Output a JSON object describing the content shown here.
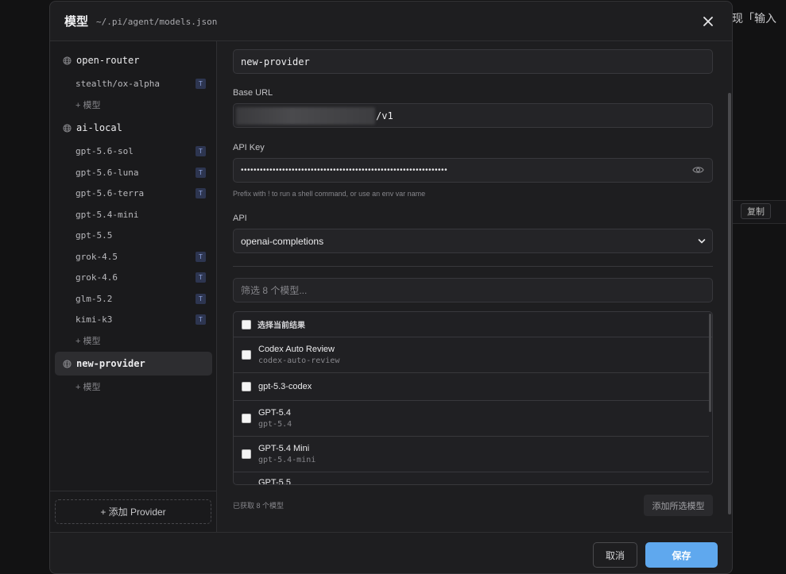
{
  "background": {
    "right_text": "现「输入",
    "copy_label": "复制"
  },
  "modal": {
    "title": "模型",
    "path": "~/.pi/agent/models.json"
  },
  "sidebar": {
    "providers": [
      {
        "name": "open-router",
        "models": [
          {
            "name": "stealth/ox-alpha",
            "badge": "T"
          }
        ],
        "add_label": "+ 模型"
      },
      {
        "name": "ai-local",
        "models": [
          {
            "name": "gpt-5.6-sol",
            "badge": "T"
          },
          {
            "name": "gpt-5.6-luna",
            "badge": "T"
          },
          {
            "name": "gpt-5.6-terra",
            "badge": "T"
          },
          {
            "name": "gpt-5.4-mini",
            "badge": ""
          },
          {
            "name": "gpt-5.5",
            "badge": ""
          },
          {
            "name": "grok-4.5",
            "badge": "T"
          },
          {
            "name": "grok-4.6",
            "badge": "T"
          },
          {
            "name": "glm-5.2",
            "badge": "T"
          },
          {
            "name": "kimi-k3",
            "badge": "T"
          }
        ],
        "add_label": "+ 模型"
      },
      {
        "name": "new-provider",
        "active": true,
        "models": [],
        "add_label": "+ 模型"
      }
    ],
    "add_provider_label": "+ 添加 Provider"
  },
  "form": {
    "provider_name_value": "new-provider",
    "base_url_label": "Base URL",
    "base_url_suffix": "/v1",
    "api_key_label": "API Key",
    "api_key_masked": "•••••••••••••••••••••••••••••••••••••••••••••••••••••••••••••••••",
    "api_key_hint": "Prefix with ! to run a shell command, or use an env var name",
    "api_label": "API",
    "api_value": "openai-completions",
    "filter_placeholder": "筛选 8 个模型...",
    "select_all_label": "选择当前结果",
    "models": [
      {
        "name": "Codex Auto Review",
        "id": "codex-auto-review"
      },
      {
        "name": "gpt-5.3-codex",
        "id": ""
      },
      {
        "name": "GPT-5.4",
        "id": "gpt-5.4"
      },
      {
        "name": "GPT-5.4 Mini",
        "id": "gpt-5.4-mini"
      },
      {
        "name": "GPT-5.5",
        "id": ""
      }
    ],
    "fetched_text": "已获取 8 个模型",
    "add_selected_label": "添加所选模型"
  },
  "footer": {
    "cancel_label": "取消",
    "save_label": "保存",
    "save_color": "#5fa8ee"
  }
}
